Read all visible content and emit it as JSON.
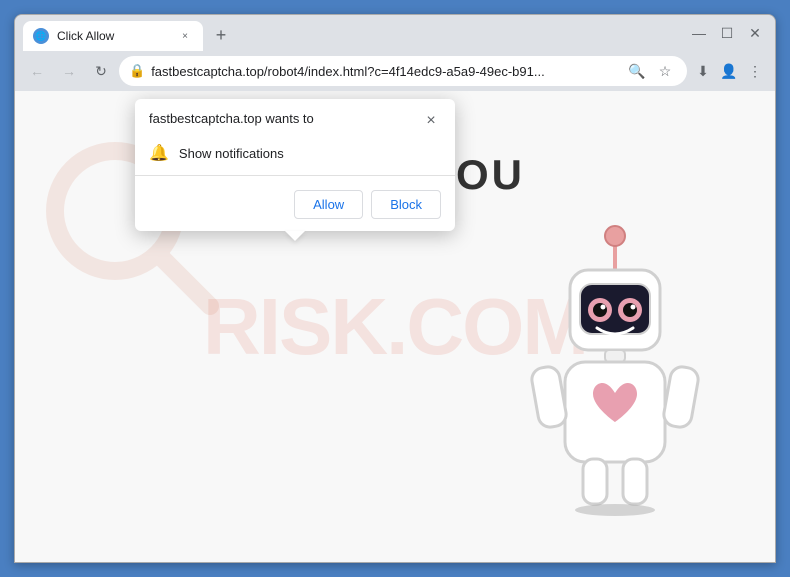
{
  "browser": {
    "tab": {
      "favicon": "🌐",
      "title": "Click Allow",
      "close_label": "×"
    },
    "new_tab_label": "+",
    "window_controls": {
      "minimize": "—",
      "maximize": "☐",
      "close": "✕"
    },
    "nav": {
      "back_label": "←",
      "forward_label": "→",
      "reload_label": "↻"
    },
    "address_bar": {
      "lock_icon": "🔒",
      "url": "fastbestcaptcha.top/robot4/index.html?c=4f14edc9-a5a9-49ec-b91...",
      "search_icon": "🔍",
      "bookmark_icon": "☆",
      "profile_icon": "👤",
      "menu_icon": "⋮"
    },
    "toolbar_right": {
      "download_icon": "⬇"
    }
  },
  "website": {
    "you_text": "YOU",
    "watermark": "RISK.COM"
  },
  "notification_popup": {
    "title": "fastbestcaptcha.top wants to",
    "close_label": "×",
    "permission": {
      "icon": "🔔",
      "text": "Show notifications"
    },
    "actions": {
      "allow_label": "Allow",
      "block_label": "Block"
    }
  }
}
